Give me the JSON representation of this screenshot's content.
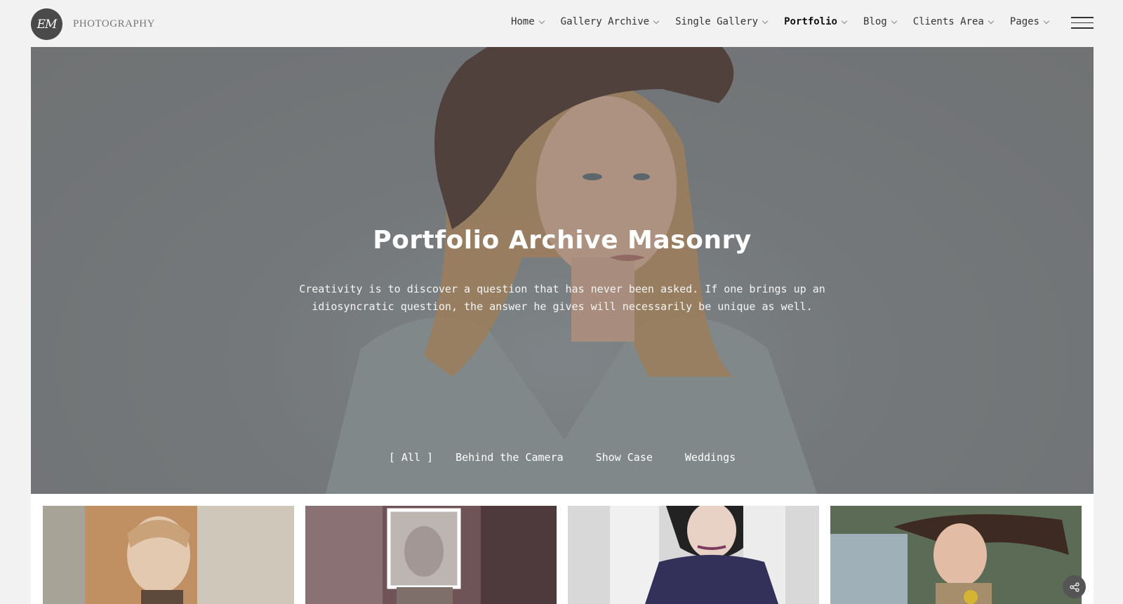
{
  "brand": {
    "monogram": "EM",
    "name": "PHOTOGRAPHY"
  },
  "nav": {
    "items": [
      {
        "label": "Home",
        "active": false
      },
      {
        "label": "Gallery Archive",
        "active": false
      },
      {
        "label": "Single Gallery",
        "active": false
      },
      {
        "label": "Portfolio",
        "active": true
      },
      {
        "label": "Blog",
        "active": false
      },
      {
        "label": "Clients Area",
        "active": false
      },
      {
        "label": "Pages",
        "active": false
      }
    ]
  },
  "hero": {
    "title": "Portfolio Archive Masonry",
    "subtitle_line1": "Creativity is to discover a question that has never been asked. If one brings up an",
    "subtitle_line2": "idiosyncratic question, the answer he gives will necessarily be unique as well."
  },
  "filters": [
    {
      "label": "[ All ]",
      "active": true
    },
    {
      "label": "Behind the Camera",
      "active": false
    },
    {
      "label": "Show Case",
      "active": false
    },
    {
      "label": "Weddings",
      "active": false
    }
  ],
  "colors": {
    "background": "#f2f2f2",
    "hero_text": "#ffffff",
    "logo_bg": "#4a4a4a"
  }
}
